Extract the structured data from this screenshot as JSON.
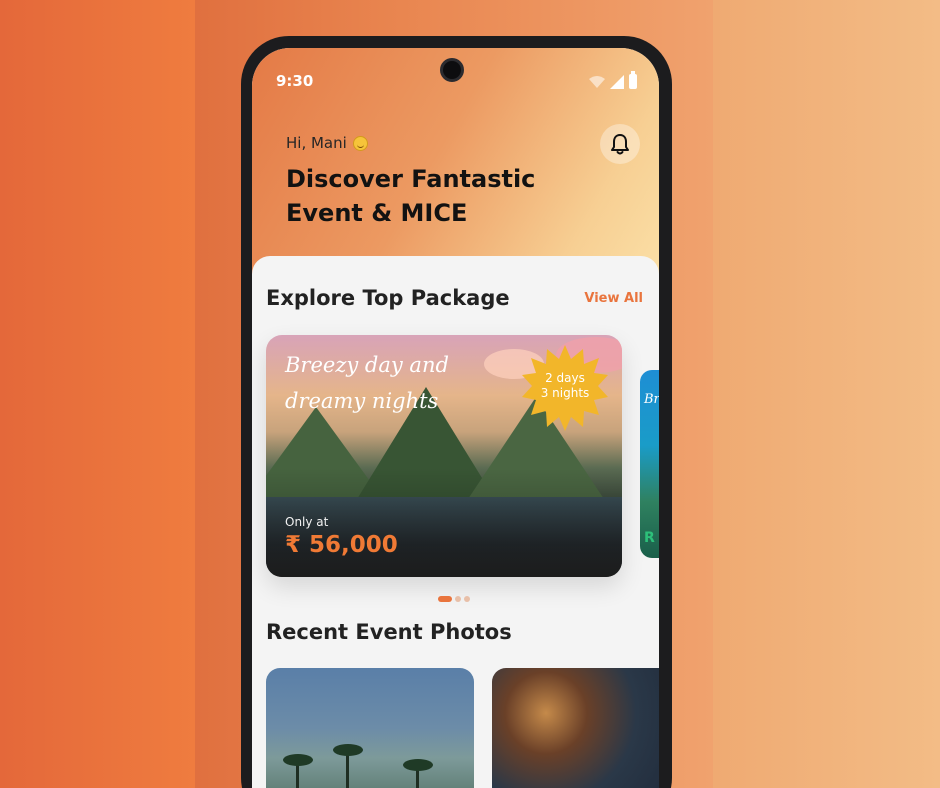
{
  "status_bar": {
    "time": "9:30"
  },
  "header": {
    "greeting": "Hi, Mani",
    "headline_line1": "Discover Fantastic",
    "headline_line2": "Event & MICE"
  },
  "packages": {
    "title": "Explore Top Package",
    "view_all_label": "View All",
    "card": {
      "script_line1": "Breezy day and",
      "script_line2": "dreamy nights",
      "badge_line1": "2 days",
      "badge_line2": "3 nights",
      "only_at": "Only at",
      "price": "₹ 56,000"
    },
    "peek_card": {
      "text_top": "Br",
      "text_bottom": "R"
    },
    "carousel": {
      "count": 3,
      "active_index": 0
    }
  },
  "recent_photos": {
    "title": "Recent Event Photos"
  },
  "colors": {
    "accent": "#e9743d",
    "price": "#f07a35",
    "badge": "#f2b62a"
  },
  "icons": [
    "bell-icon",
    "wifi-icon",
    "signal-icon",
    "battery-icon",
    "smile-emoji-icon"
  ]
}
